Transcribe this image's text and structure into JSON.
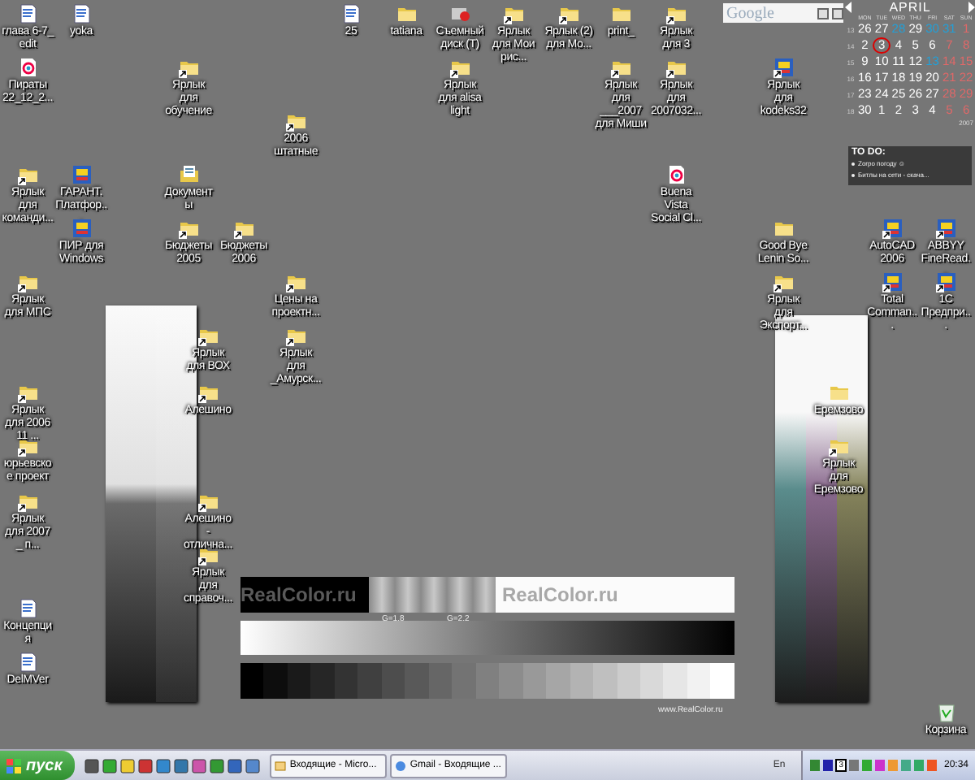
{
  "google_bar": {
    "logo": "Google"
  },
  "icons": [
    {
      "label": "глава 6-7_ edit",
      "kind": "document",
      "shortcut": false
    },
    {
      "label": "yoka",
      "kind": "document",
      "shortcut": false
    },
    {
      "label": "25",
      "kind": "document",
      "shortcut": false
    },
    {
      "label": "tatiana",
      "kind": "folder",
      "shortcut": false
    },
    {
      "label": "Съемный диск (T)",
      "kind": "drive",
      "shortcut": false
    },
    {
      "label": "Ярлык для Мои рис...",
      "kind": "folder",
      "shortcut": true
    },
    {
      "label": "Ярлык (2) для Мо...",
      "kind": "folder",
      "shortcut": true
    },
    {
      "label": "print_",
      "kind": "folder",
      "shortcut": false
    },
    {
      "label": "Ярлык для 3",
      "kind": "folder",
      "shortcut": true
    },
    {
      "label": "Пираты 22_12_2...",
      "kind": "media",
      "shortcut": false
    },
    {
      "label": "Ярлык для обучение",
      "kind": "folder",
      "shortcut": true
    },
    {
      "label": "Ярлык для alisa light",
      "kind": "folder",
      "shortcut": true
    },
    {
      "label": "Ярлык для ___2007 для Миши",
      "kind": "folder",
      "shortcut": true
    },
    {
      "label": "Ярлык для 2007032...",
      "kind": "folder",
      "shortcut": true
    },
    {
      "label": "Ярлык для kodeks32",
      "kind": "app",
      "shortcut": true
    },
    {
      "label": "2006 штатные",
      "kind": "folder",
      "shortcut": true
    },
    {
      "label": "Ярлык для команди...",
      "kind": "folder",
      "shortcut": true
    },
    {
      "label": "ГАРАНТ. Платфор...",
      "kind": "app",
      "shortcut": false
    },
    {
      "label": "Документы",
      "kind": "document-folder",
      "shortcut": false
    },
    {
      "label": "Buena Vista Social Cl...",
      "kind": "media",
      "shortcut": false
    },
    {
      "label": "ПИР для Windows",
      "kind": "app",
      "shortcut": false
    },
    {
      "label": "Бюджеты 2005",
      "kind": "folder",
      "shortcut": true
    },
    {
      "label": "Бюджеты 2006",
      "kind": "folder",
      "shortcut": true
    },
    {
      "label": "Good Bye Lenin So...",
      "kind": "folder",
      "shortcut": false
    },
    {
      "label": "AutoCAD 2006",
      "kind": "app",
      "shortcut": true
    },
    {
      "label": "ABBYY FineRead...",
      "kind": "app",
      "shortcut": true
    },
    {
      "label": "Ярлык для МПС",
      "kind": "folder",
      "shortcut": true
    },
    {
      "label": "Цены на проектн...",
      "kind": "folder",
      "shortcut": true
    },
    {
      "label": "Ярлык для Экспорт...",
      "kind": "folder",
      "shortcut": true
    },
    {
      "label": "Total Comman...",
      "kind": "app",
      "shortcut": true
    },
    {
      "label": "1С Предпри...",
      "kind": "app",
      "shortcut": true
    },
    {
      "label": "Ярлык для ВОХ",
      "kind": "folder",
      "shortcut": true
    },
    {
      "label": "Ярлык для _Амурск...",
      "kind": "folder",
      "shortcut": true
    },
    {
      "label": "Ярлык для 2006 11 ...",
      "kind": "folder",
      "shortcut": true
    },
    {
      "label": "Алешино",
      "kind": "folder",
      "shortcut": true
    },
    {
      "label": "Еремзово",
      "kind": "folder",
      "shortcut": false
    },
    {
      "label": "юрьевское проект",
      "kind": "folder",
      "shortcut": true
    },
    {
      "label": "Ярлык для Еремзово",
      "kind": "folder",
      "shortcut": true
    },
    {
      "label": "Ярлык для 2007 _ п...",
      "kind": "folder",
      "shortcut": true
    },
    {
      "label": "Алешино - отлична...",
      "kind": "folder",
      "shortcut": true
    },
    {
      "label": "Ярлык для справоч...",
      "kind": "folder",
      "shortcut": true
    },
    {
      "label": "Концепция",
      "kind": "document",
      "shortcut": false
    },
    {
      "label": "DelMVer",
      "kind": "document",
      "shortcut": false
    },
    {
      "label": "Корзина",
      "kind": "recycle",
      "shortcut": false
    }
  ],
  "calendar": {
    "month": "APRIL",
    "weekdays": [
      "MON",
      "TUE",
      "WED",
      "THU",
      "FRI",
      "SAT",
      "SUN"
    ],
    "weeks": [
      {
        "number": "13",
        "days": [
          {
            "d": "26",
            "color": "#ffffff",
            "selected": false
          },
          {
            "d": "27",
            "color": "#ffffff",
            "selected": false
          },
          {
            "d": "28",
            "color": "#22a0d8",
            "selected": false
          },
          {
            "d": "29",
            "color": "#ffffff",
            "selected": false
          },
          {
            "d": "30",
            "color": "#22a0d8",
            "selected": false
          },
          {
            "d": "31",
            "color": "#22a0d8",
            "selected": false
          },
          {
            "d": "1",
            "color": "#e06868",
            "selected": false
          }
        ]
      },
      {
        "number": "14",
        "days": [
          {
            "d": "2",
            "color": "#ffffff",
            "selected": false
          },
          {
            "d": "3",
            "color": "#ffffff",
            "selected": true
          },
          {
            "d": "4",
            "color": "#ffffff",
            "selected": false
          },
          {
            "d": "5",
            "color": "#ffffff",
            "selected": false
          },
          {
            "d": "6",
            "color": "#ffffff",
            "selected": false
          },
          {
            "d": "7",
            "color": "#e06868",
            "selected": false
          },
          {
            "d": "8",
            "color": "#e06868",
            "selected": false
          }
        ]
      },
      {
        "number": "15",
        "days": [
          {
            "d": "9",
            "color": "#ffffff",
            "selected": false
          },
          {
            "d": "10",
            "color": "#ffffff",
            "selected": false
          },
          {
            "d": "11",
            "color": "#ffffff",
            "selected": false
          },
          {
            "d": "12",
            "color": "#ffffff",
            "selected": false
          },
          {
            "d": "13",
            "color": "#22a0d8",
            "selected": false
          },
          {
            "d": "14",
            "color": "#e06868",
            "selected": false
          },
          {
            "d": "15",
            "color": "#e06868",
            "selected": false
          }
        ]
      },
      {
        "number": "16",
        "days": [
          {
            "d": "16",
            "color": "#ffffff",
            "selected": false
          },
          {
            "d": "17",
            "color": "#ffffff",
            "selected": false
          },
          {
            "d": "18",
            "color": "#ffffff",
            "selected": false
          },
          {
            "d": "19",
            "color": "#ffffff",
            "selected": false
          },
          {
            "d": "20",
            "color": "#ffffff",
            "selected": false
          },
          {
            "d": "21",
            "color": "#e06868",
            "selected": false
          },
          {
            "d": "22",
            "color": "#e06868",
            "selected": false
          }
        ]
      },
      {
        "number": "17",
        "days": [
          {
            "d": "23",
            "color": "#ffffff",
            "selected": false
          },
          {
            "d": "24",
            "color": "#ffffff",
            "selected": false
          },
          {
            "d": "25",
            "color": "#ffffff",
            "selected": false
          },
          {
            "d": "26",
            "color": "#ffffff",
            "selected": false
          },
          {
            "d": "27",
            "color": "#ffffff",
            "selected": false
          },
          {
            "d": "28",
            "color": "#e06868",
            "selected": false
          },
          {
            "d": "29",
            "color": "#e06868",
            "selected": false
          }
        ]
      },
      {
        "number": "18",
        "days": [
          {
            "d": "30",
            "color": "#ffffff",
            "selected": false
          },
          {
            "d": "1",
            "color": "#ffffff",
            "selected": false
          },
          {
            "d": "2",
            "color": "#ffffff",
            "selected": false
          },
          {
            "d": "3",
            "color": "#ffffff",
            "selected": false
          },
          {
            "d": "4",
            "color": "#ffffff",
            "selected": false
          },
          {
            "d": "5",
            "color": "#e06868",
            "selected": false
          },
          {
            "d": "6",
            "color": "#e06868",
            "selected": false
          }
        ]
      }
    ],
    "year": "2007"
  },
  "todo": {
    "title": "TO DO:",
    "items": [
      "Zorpo погоду ☺",
      "Битлы на сети - скача..."
    ]
  },
  "wallpaper": {
    "banner_texts": [
      "RealColor.ru",
      "RealColor.ru"
    ],
    "gamma_labels": [
      "G=1.8",
      "G=2.2"
    ],
    "url": "www.RealColor.ru"
  },
  "taskbar": {
    "start": "пуск",
    "tasks": [
      {
        "label": "Входящие - Micro...",
        "kind": "mail",
        "selected": false
      },
      {
        "label": "Gmail - Входящие ...",
        "kind": "browser",
        "selected": false
      }
    ],
    "language": "En",
    "tray_badge": "3",
    "clock": "20:34"
  }
}
